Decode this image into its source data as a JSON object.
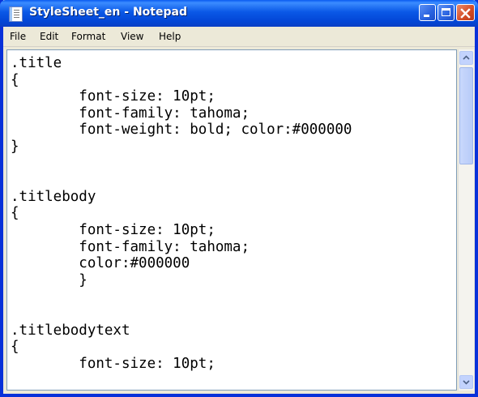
{
  "window": {
    "title": "StyleSheet_en - Notepad"
  },
  "menu": [
    {
      "label": "File"
    },
    {
      "label": "Edit"
    },
    {
      "label": "Format"
    },
    {
      "label": "View"
    },
    {
      "label": "Help"
    }
  ],
  "icons": {
    "app": "notepad-icon",
    "minimize": "minimize-icon",
    "maximize": "maximize-icon",
    "close": "close-icon",
    "scroll_up": "scroll-up-icon",
    "scroll_down": "scroll-down-icon"
  },
  "editor": {
    "content": ".title\n{\n        font-size: 10pt;\n        font-family: tahoma;\n        font-weight: bold; color:#000000\n}\n\n\n.titlebody\n{\n        font-size: 10pt;\n        font-family: tahoma;\n        color:#000000\n        }\n\n\n.titlebodytext\n{\n        font-size: 10pt;"
  },
  "colors": {
    "titlebar": "#0a58e6",
    "close_button": "#d34a23",
    "window_frame": "#0831d9",
    "menubar": "#ece9d8"
  }
}
